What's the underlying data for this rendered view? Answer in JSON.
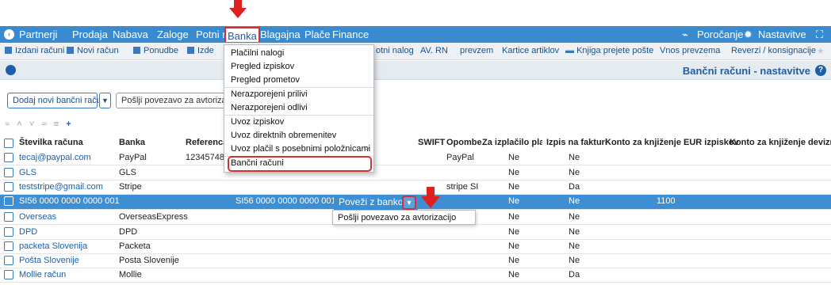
{
  "colors": {
    "accent": "#3a8ad0",
    "selected_row": "#3e8ed4",
    "highlight": "#d63030",
    "link": "#1d5fa8"
  },
  "menubar": {
    "items": [
      "Partnerji",
      "Prodaja",
      "Nabava",
      "Zaloge",
      "Potni nalogi",
      "Banka",
      "Blagajna",
      "Plače",
      "Finance"
    ],
    "active": "Banka",
    "right": {
      "reports": "Poročanje",
      "settings": "Nastavitve"
    }
  },
  "toolbar": {
    "items": [
      "Izdani računi",
      "Novi račun",
      "Ponudbe",
      "Izde",
      "otni nalog",
      "AV. RN",
      "prevzem",
      "Kartice artiklov",
      "Knjiga prejete pošte",
      "Vnos prevzema",
      "Reverzi / konsignacije"
    ]
  },
  "header": {
    "title": "Bančni računi - nastavitve"
  },
  "buttons": {
    "add_account": "Dodaj novi bančni račun",
    "send_link": "Pošlji povezavo za avtorizaci"
  },
  "banka_menu": {
    "items": [
      "Plačilni nalogi",
      "Pregled izpiskov",
      "Pregled prometov",
      "Nerazporejeni prilivi",
      "Nerazporejeni odlivi",
      "Uvoz izpiskov",
      "Uvoz direktnih obremenitev",
      "Uvoz plačil s posebnimi položnicami",
      "Bančni računi"
    ],
    "submenu_marker": ">"
  },
  "table": {
    "columns": [
      "Številka računa",
      "Banka",
      "Referenca",
      "SWIFT",
      "Opombe",
      "Za izplačilo plač",
      "Izpis na fakturi",
      "Konto za knjiženje EUR izpiskov",
      "Konto za knjiženje deviznih"
    ],
    "rows": [
      {
        "account": "tecaj@paypal.com",
        "bank": "PayPal",
        "ref": "12345748",
        "note": "PayPal",
        "payroll": "Ne",
        "invoice": "Ne",
        "konto": ""
      },
      {
        "account": "GLS",
        "bank": "GLS",
        "ref": "",
        "note": "",
        "payroll": "Ne",
        "invoice": "Ne",
        "konto": ""
      },
      {
        "account": "teststripe@gmail.com",
        "bank": "Stripe",
        "ref": "",
        "note": "stripe SI",
        "payroll": "Ne",
        "invoice": "Da",
        "konto": ""
      },
      {
        "account": "SI56 0000 0000 0000 001",
        "bank": "",
        "ref": "SI56 0000 0000 0000 001",
        "note": "",
        "payroll": "Ne",
        "invoice": "Ne",
        "konto": "1100"
      },
      {
        "account": "Overseas",
        "bank": "OverseasExpress",
        "ref": "",
        "note": "",
        "payroll": "Ne",
        "invoice": "Ne",
        "konto": ""
      },
      {
        "account": "DPD",
        "bank": "DPD",
        "ref": "",
        "note": "",
        "payroll": "Ne",
        "invoice": "Ne",
        "konto": ""
      },
      {
        "account": "packeta Slovenija",
        "bank": "Packeta",
        "ref": "",
        "note": "",
        "payroll": "Ne",
        "invoice": "Ne",
        "konto": ""
      },
      {
        "account": "Pošta Slovenije",
        "bank": "Posta Slovenije",
        "ref": "",
        "note": "",
        "payroll": "Ne",
        "invoice": "Ne",
        "konto": ""
      },
      {
        "account": "Mollie račun",
        "bank": "Mollie",
        "ref": "",
        "note": "",
        "payroll": "Ne",
        "invoice": "Da",
        "konto": ""
      }
    ]
  },
  "row_action": {
    "label": "Poveži z banko",
    "popup_item": "Pošlji povezavo za avtorizacijo"
  }
}
